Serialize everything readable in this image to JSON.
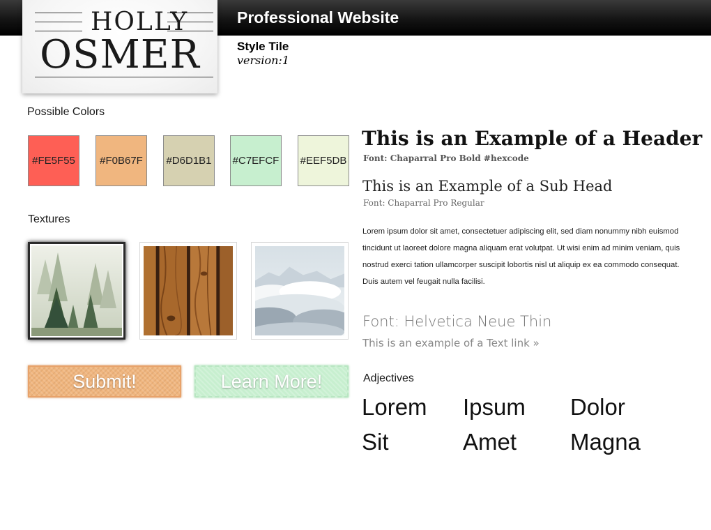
{
  "header": {
    "site_title": "Professional Website",
    "tile_label": "Style Tile",
    "version": "version:1"
  },
  "logo": {
    "line1": "HOLLY",
    "line2": "OSMER"
  },
  "colors": {
    "label": "Possible Colors",
    "swatches": [
      {
        "hex": "#FE5F55",
        "label": "#FE5F55"
      },
      {
        "hex": "#F0B67F",
        "label": "#F0B67F"
      },
      {
        "hex": "#D6D1B1",
        "label": "#D6D1B1"
      },
      {
        "hex": "#C7EFCF",
        "label": "#C7EFCF"
      },
      {
        "hex": "#EEF5DB",
        "label": "#EEF5DB"
      }
    ]
  },
  "textures": {
    "label": "Textures",
    "items": [
      {
        "name": "foggy-forest"
      },
      {
        "name": "wood-planks"
      },
      {
        "name": "clouds"
      }
    ]
  },
  "buttons": {
    "submit": "Submit!",
    "learn_more": "Learn More!"
  },
  "typography": {
    "header_example": "This is an Example of a Header",
    "header_note": "Font: Chaparral Pro Bold #hexcode",
    "subhead_example": "This is an Example of a Sub Head",
    "subhead_note": "Font: Chaparral Pro Regular",
    "body": "Lorem ipsum dolor sit amet, consectetuer adipiscing elit, sed diam nonummy nibh euismod tincidunt ut laoreet dolore magna aliquam erat volutpat. Ut wisi enim ad minim veniam, quis nostrud exerci tation ullamcorper suscipit lobortis nisl ut aliquip ex ea commodo consequat. Duis autem vel feugait nulla facilisi.",
    "thin_font_label": "Font: Helvetica Neue Thin",
    "text_link": "This is an example of a Text link »"
  },
  "adjectives": {
    "label": "Adjectives",
    "words": [
      "Lorem",
      "Ipsum",
      "Dolor",
      "Sit",
      "Amet",
      "Magna"
    ]
  }
}
